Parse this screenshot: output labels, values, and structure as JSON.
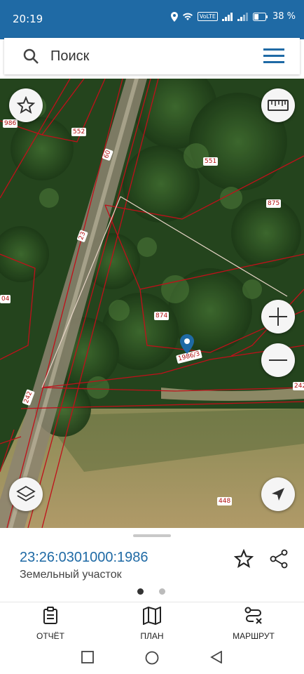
{
  "status_bar": {
    "time": "20:19",
    "network_badge": "VoLTE",
    "battery": "38 %"
  },
  "search": {
    "placeholder": "Поиск"
  },
  "map": {
    "parcel_labels": [
      "986",
      "552",
      "60",
      "551",
      "875",
      "23",
      "874",
      "1986/3",
      "242",
      "242",
      "448",
      "04"
    ]
  },
  "selected_parcel": {
    "cadastral_number": "23:26:0301000:1986",
    "type": "Земельный участок"
  },
  "bottom_tabs": {
    "report": "ОТЧЁТ",
    "plan": "ПЛАН",
    "route": "МАРШРУТ"
  },
  "colors": {
    "status_bar": "#1f6aa5",
    "accent": "#1f6aa5",
    "parcel_border": "#c0101a"
  }
}
